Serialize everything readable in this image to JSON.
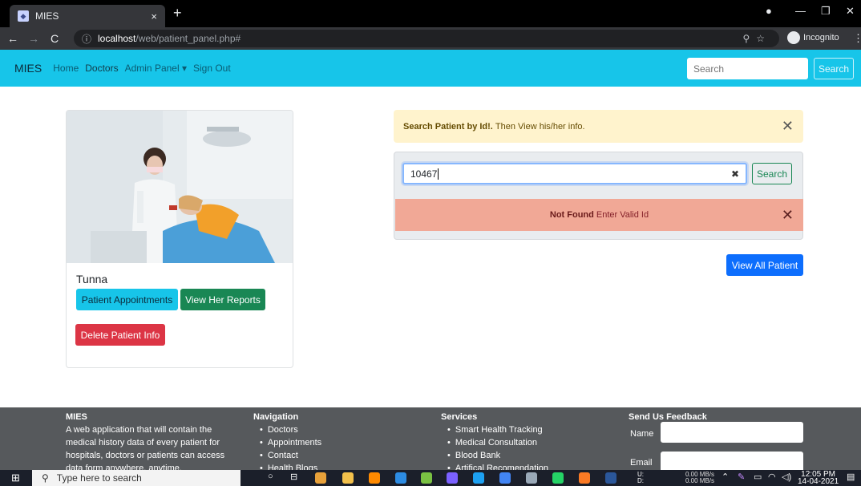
{
  "browser": {
    "tab_title": "MIES",
    "tab_close": "×",
    "new_tab": "+",
    "url_host": "localhost",
    "url_path": "/web/patient_panel.php#",
    "incognito_label": "Incognito",
    "window_controls": [
      "—",
      "❐",
      "✕"
    ]
  },
  "navbar": {
    "brand": "MIES",
    "links": [
      "Home",
      "Doctors",
      "Admin Panel ▾",
      "Sign Out"
    ],
    "search_placeholder": "Search",
    "search_button": "Search"
  },
  "patient_card": {
    "name": "Tunna",
    "appointments_button": "Patient Appointments",
    "reports_button": "View Her Reports",
    "delete_button": "Delete Patient Info"
  },
  "search_panel": {
    "hint_bold": "Search Patient by Id!.",
    "hint_text": "Then View his/her info.",
    "input_value": "10467",
    "search_button": "Search",
    "error_bold": "Not Found",
    "error_text": "Enter Valid Id",
    "view_all_button": "View All Patient"
  },
  "footer": {
    "about_title": "MIES",
    "about_text": "A web application that will contain the medical history data of every patient for hospitals, doctors or patients can access data form anywhere, anytime.",
    "navigation_title": "Navigation",
    "navigation_items": [
      "Doctors",
      "Appointments",
      "Contact",
      "Health Blogs"
    ],
    "services_title": "Services",
    "services_items": [
      "Smart Health Tracking",
      "Medical Consultation",
      "Blood Bank",
      "Artifical Recomendation"
    ],
    "feedback_title": "Send Us Feedback",
    "name_label": "Name",
    "email_label": "Email"
  },
  "taskbar": {
    "search_placeholder": "Type here to search",
    "net_up": "0.00 MB/s",
    "net_down": "0.00 MB/s",
    "time": "12:05 PM",
    "date": "14-04-2021"
  }
}
